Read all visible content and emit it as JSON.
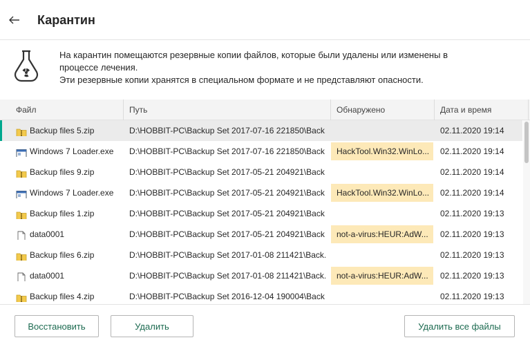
{
  "header": {
    "title": "Карантин"
  },
  "info": {
    "line1": "На карантин помещаются резервные копии файлов, которые были удалены или изменены в",
    "line2": "процессе лечения.",
    "line3": "Эти резервные копии хранятся в специальном формате и не представляют опасности."
  },
  "table": {
    "columns": {
      "name": "Файл",
      "path": "Путь",
      "detected": "Обнаружено",
      "date": "Дата и время"
    },
    "rows": [
      {
        "icon": "zip-folder-icon",
        "name": "Backup files 5.zip",
        "path": "D:\\HOBBIT-PC\\Backup Set 2017-07-16 221850\\Back...",
        "detected": "",
        "date": "02.11.2020 19:14"
      },
      {
        "icon": "exe-window-icon",
        "name": "Windows 7 Loader.exe",
        "path": "D:\\HOBBIT-PC\\Backup Set 2017-07-16 221850\\Back...",
        "detected": "HackTool.Win32.WinLo...",
        "date": "02.11.2020 19:14"
      },
      {
        "icon": "zip-folder-icon",
        "name": "Backup files 9.zip",
        "path": "D:\\HOBBIT-PC\\Backup Set 2017-05-21 204921\\Back...",
        "detected": "",
        "date": "02.11.2020 19:14"
      },
      {
        "icon": "exe-window-icon",
        "name": "Windows 7 Loader.exe",
        "path": "D:\\HOBBIT-PC\\Backup Set 2017-05-21 204921\\Back...",
        "detected": "HackTool.Win32.WinLo...",
        "date": "02.11.2020 19:14"
      },
      {
        "icon": "zip-folder-icon",
        "name": "Backup files 1.zip",
        "path": "D:\\HOBBIT-PC\\Backup Set 2017-05-21 204921\\Back...",
        "detected": "",
        "date": "02.11.2020 19:13"
      },
      {
        "icon": "blank-file-icon",
        "name": "data0001",
        "path": "D:\\HOBBIT-PC\\Backup Set 2017-05-21 204921\\Back...",
        "detected": "not-a-virus:HEUR:AdW...",
        "date": "02.11.2020 19:13"
      },
      {
        "icon": "zip-folder-icon",
        "name": "Backup files 6.zip",
        "path": "D:\\HOBBIT-PC\\Backup Set 2017-01-08 211421\\Back...",
        "detected": "",
        "date": "02.11.2020 19:13"
      },
      {
        "icon": "blank-file-icon",
        "name": "data0001",
        "path": "D:\\HOBBIT-PC\\Backup Set 2017-01-08 211421\\Back...",
        "detected": "not-a-virus:HEUR:AdW...",
        "date": "02.11.2020 19:13"
      },
      {
        "icon": "zip-folder-icon",
        "name": "Backup files 4.zip",
        "path": "D:\\HOBBIT-PC\\Backup Set 2016-12-04 190004\\Back...",
        "detected": "",
        "date": "02.11.2020 19:13"
      }
    ]
  },
  "footer": {
    "restore_label": "Восстановить",
    "delete_label": "Удалить",
    "delete_all_label": "Удалить все файлы"
  },
  "colors": {
    "accent": "#00a88e",
    "button_text": "#1c6a50",
    "detected_highlight": "#fde9b8",
    "selected_row": "#ebebeb"
  }
}
